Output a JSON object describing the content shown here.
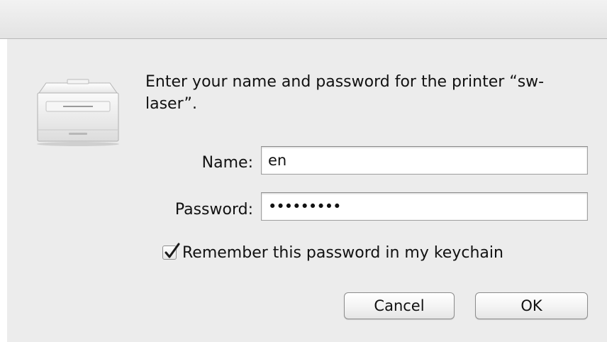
{
  "dialog": {
    "message": "Enter your name and password for the printer “sw-laser”.",
    "icon": "printer-icon"
  },
  "form": {
    "name_label": "Name:",
    "name_value": "en",
    "password_label": "Password:",
    "password_value": "•••••••••",
    "remember_label": "Remember this password in my keychain",
    "remember_checked": true
  },
  "buttons": {
    "cancel_label": "Cancel",
    "ok_label": "OK"
  }
}
